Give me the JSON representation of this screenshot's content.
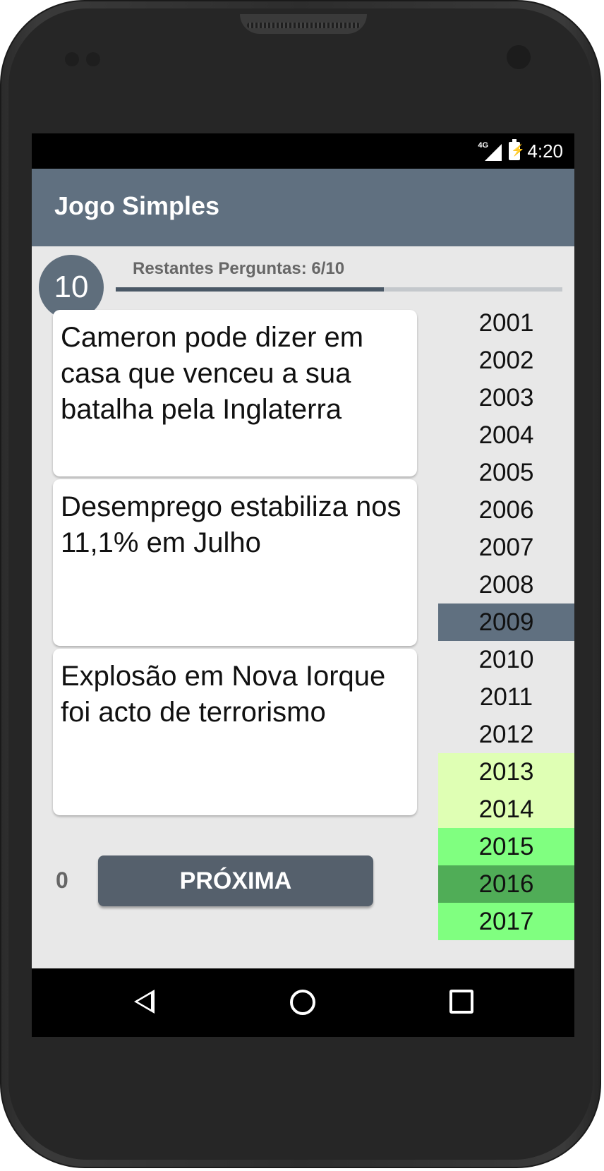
{
  "status": {
    "network": "4G",
    "time": "4:20"
  },
  "app": {
    "title": "Jogo Simples"
  },
  "timer": {
    "value": "10"
  },
  "progress": {
    "label": "Restantes Perguntas: 6/10",
    "fraction": 0.6
  },
  "cards": [
    {
      "text": "Cameron pode dizer em casa que venceu a sua batalha pela Inglaterra"
    },
    {
      "text": "Desemprego estabiliza nos 11,1% em Julho"
    },
    {
      "text": "Explosão em Nova Iorque foi acto de terrorismo"
    }
  ],
  "years": [
    {
      "label": "2001",
      "color": ""
    },
    {
      "label": "2002",
      "color": ""
    },
    {
      "label": "2003",
      "color": ""
    },
    {
      "label": "2004",
      "color": ""
    },
    {
      "label": "2005",
      "color": ""
    },
    {
      "label": "2006",
      "color": ""
    },
    {
      "label": "2007",
      "color": ""
    },
    {
      "label": "2008",
      "color": ""
    },
    {
      "label": "2009",
      "color": "#607080",
      "selected": true
    },
    {
      "label": "2010",
      "color": ""
    },
    {
      "label": "2011",
      "color": ""
    },
    {
      "label": "2012",
      "color": ""
    },
    {
      "label": "2013",
      "color": "#dfffb4"
    },
    {
      "label": "2014",
      "color": "#dfffb4"
    },
    {
      "label": "2015",
      "color": "#80ff80"
    },
    {
      "label": "2016",
      "color": "#50ad57"
    },
    {
      "label": "2017",
      "color": "#80ff80"
    }
  ],
  "footer": {
    "score": "0",
    "next_label": "PRÓXIMA"
  },
  "nav": {
    "back_icon": "back-triangle-icon",
    "home_icon": "home-circle-icon",
    "recent_icon": "recent-square-icon"
  }
}
